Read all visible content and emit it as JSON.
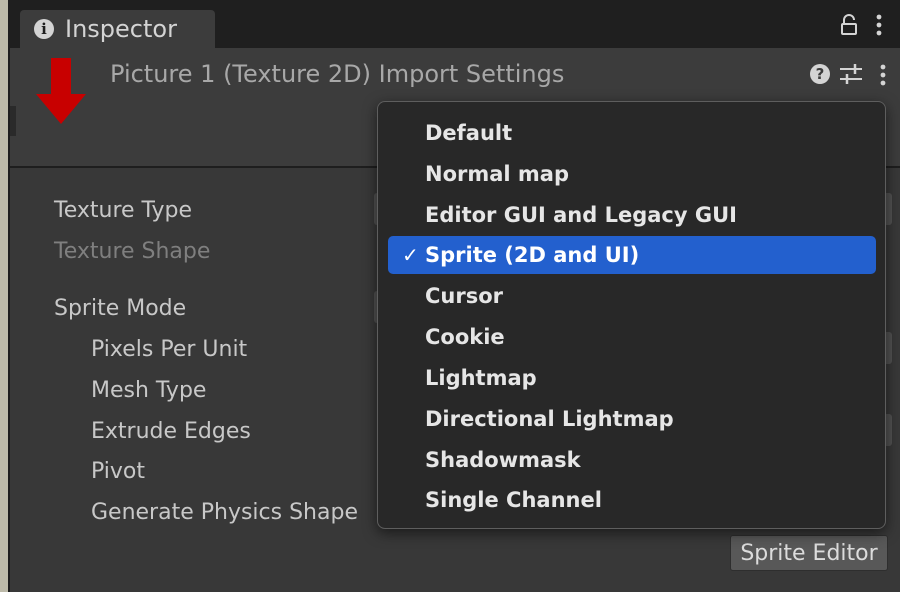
{
  "tab": {
    "title": "Inspector"
  },
  "header": {
    "title": "Picture 1 (Texture 2D) Import Settings"
  },
  "properties": [
    {
      "label": "Texture Type",
      "enabled": true
    },
    {
      "label": "Texture Shape",
      "enabled": false
    },
    {
      "label": "Sprite Mode",
      "enabled": true
    },
    {
      "label": "Pixels Per Unit",
      "enabled": true
    },
    {
      "label": "Mesh Type",
      "enabled": true
    },
    {
      "label": "Extrude Edges",
      "enabled": true
    },
    {
      "label": "Pivot",
      "enabled": true
    },
    {
      "label": "Generate Physics Shape",
      "enabled": true
    }
  ],
  "buttons": {
    "sprite_editor": "Sprite Editor"
  },
  "dropdown": {
    "check_glyph": "✓",
    "selected_index": 3,
    "options": [
      "Default",
      "Normal map",
      "Editor GUI and Legacy GUI",
      "Sprite (2D and UI)",
      "Cursor",
      "Cookie",
      "Lightmap",
      "Directional Lightmap",
      "Shadowmask",
      "Single Channel"
    ]
  },
  "icons": {
    "info": "info-icon",
    "lock": "lock-icon",
    "menu": "vertical-dots-icon",
    "help": "help-icon",
    "presets": "sliders-icon",
    "annotation": "red-down-arrow-icon"
  },
  "colors": {
    "accent": "#2360ce",
    "annotation_arrow": "#c80000",
    "panel": "#383838",
    "tabbar": "#1f1f1f"
  }
}
